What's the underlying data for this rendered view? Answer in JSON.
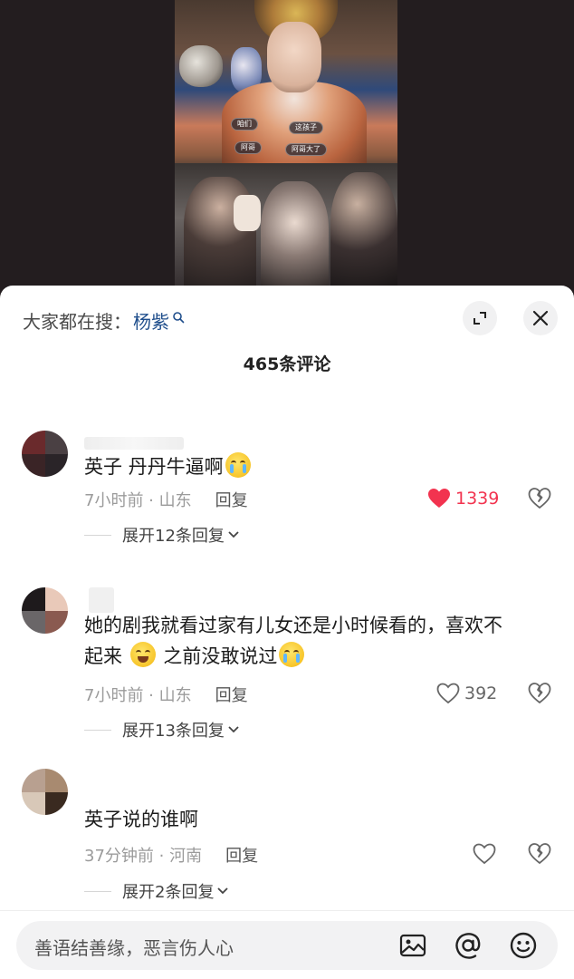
{
  "video": {
    "subtitles": [
      "这孩子",
      "阿哥大了",
      "咱们",
      "阿哥"
    ]
  },
  "search": {
    "prefix": "大家都在搜：",
    "term": "杨紫"
  },
  "comment_count": "465条评论",
  "comments": [
    {
      "text": "英子 丹丹牛逼啊",
      "emojis": [
        "crying-face"
      ],
      "time_location": "7小时前 · 山东",
      "reply_label": "回复",
      "likes": "1339",
      "liked": true,
      "expand_label": "展开12条回复"
    },
    {
      "text_line1": "她的剧我就看过家有儿女还是小时候看的，喜欢不",
      "text_line2a": "起来",
      "text_line2b": "之前没敢说过",
      "emojis": [
        "grinning-sweat-face",
        "crying-face"
      ],
      "time_location": "7小时前 · 山东",
      "reply_label": "回复",
      "likes": "392",
      "liked": false,
      "expand_label": "展开13条回复"
    },
    {
      "text": "英子说的谁啊",
      "time_location": "37分钟前 · 河南",
      "reply_label": "回复",
      "likes": "",
      "liked": false,
      "expand_label": "展开2条回复"
    }
  ],
  "input": {
    "placeholder": "善语结善缘，恶言伤人心"
  },
  "colors": {
    "accent_like": "#f2334f",
    "search_term": "#1f4e8c"
  }
}
